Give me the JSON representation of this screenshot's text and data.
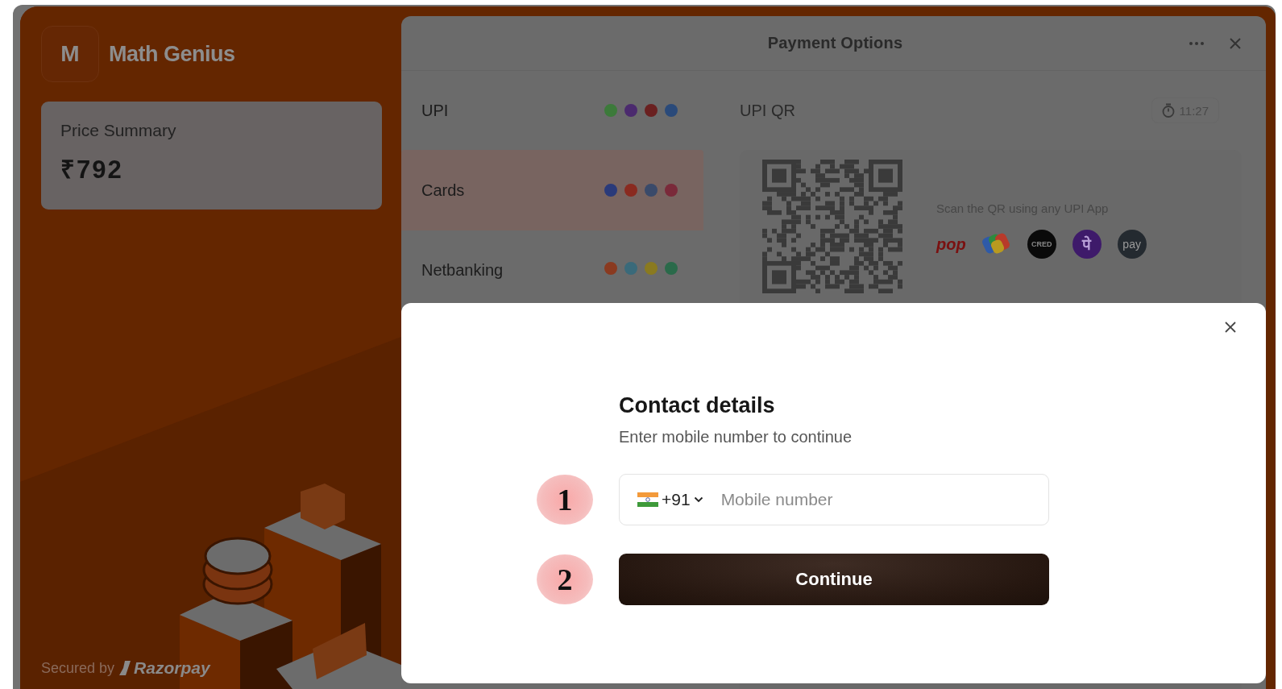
{
  "merchant": {
    "logo_letter": "M",
    "name": "Math Genius"
  },
  "price_summary": {
    "label": "Price Summary",
    "amount": "₹792"
  },
  "footer": {
    "secured_by": "Secured by",
    "brand": "Razorpay"
  },
  "payment_options": {
    "title": "Payment Options",
    "methods": [
      {
        "label": "UPI",
        "kind": "upi",
        "selected": false
      },
      {
        "label": "Cards",
        "kind": "cards",
        "selected": true
      },
      {
        "label": "Netbanking",
        "kind": "netbanking",
        "selected": false
      }
    ],
    "upi_qr": {
      "title": "UPI QR",
      "timer": "11:27",
      "scan_hint": "Scan the QR using any UPI App",
      "apps": [
        {
          "kind": "pop",
          "label": "pop"
        },
        {
          "kind": "gpay"
        },
        {
          "kind": "cred",
          "label": "CRED"
        },
        {
          "kind": "phonepe",
          "label": "पे"
        },
        {
          "kind": "amazonpay",
          "label": "pay"
        }
      ]
    }
  },
  "contact_modal": {
    "title": "Contact details",
    "subtitle": "Enter mobile number to continue",
    "country_code": "+91",
    "phone": {
      "placeholder": "Mobile number"
    },
    "button": "Continue"
  },
  "annotations": [
    {
      "label": "1"
    },
    {
      "label": "2"
    }
  ]
}
